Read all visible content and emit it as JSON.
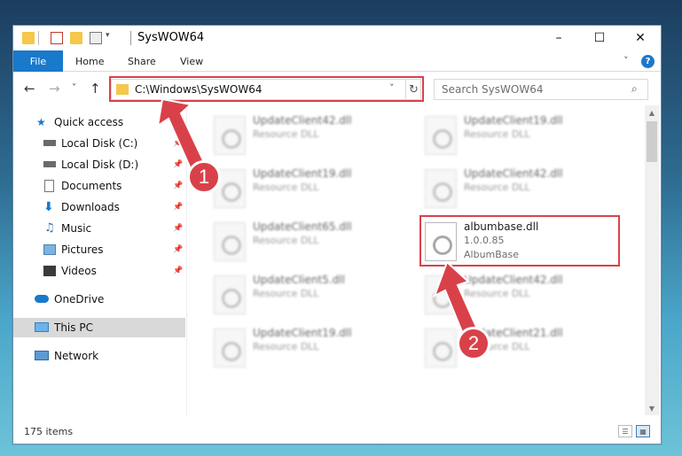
{
  "window": {
    "title": "SysWOW64",
    "controls": {
      "minimize": "–",
      "maximize": "☐",
      "close": "✕"
    }
  },
  "ribbon": {
    "tabs": [
      "File",
      "Home",
      "Share",
      "View"
    ],
    "collapse_glyph": "˅",
    "help_glyph": "?"
  },
  "nav": {
    "back": "←",
    "forward": "→",
    "recent": "˅",
    "up": "↑",
    "address": "C:\\Windows\\SysWOW64",
    "address_dropdown": "˅",
    "refresh": "↻",
    "search_placeholder": "Search SysWOW64",
    "search_glyph": "⌕"
  },
  "sidebar": {
    "items": [
      {
        "label": "Quick access",
        "icon": "star-icon",
        "pinned": false
      },
      {
        "label": "Local Disk (C:)",
        "icon": "drive-icon",
        "pinned": true
      },
      {
        "label": "Local Disk (D:)",
        "icon": "drive-icon",
        "pinned": true
      },
      {
        "label": "Documents",
        "icon": "document-icon",
        "pinned": true
      },
      {
        "label": "Downloads",
        "icon": "download-icon",
        "pinned": true
      },
      {
        "label": "Music",
        "icon": "music-icon",
        "pinned": true
      },
      {
        "label": "Pictures",
        "icon": "pictures-icon",
        "pinned": true
      },
      {
        "label": "Videos",
        "icon": "video-icon",
        "pinned": true
      },
      {
        "label": "OneDrive",
        "icon": "cloud-icon",
        "pinned": false
      },
      {
        "label": "This PC",
        "icon": "computer-icon",
        "pinned": false,
        "selected": true
      },
      {
        "label": "Network",
        "icon": "network-icon",
        "pinned": false
      }
    ]
  },
  "files": {
    "left_column": [
      {
        "name": "UpdateClient42.dll",
        "type": "Resource DLL"
      },
      {
        "name": "UpdateClient19.dll",
        "type": "Resource DLL"
      },
      {
        "name": "UpdateClient65.dll",
        "type": "Resource DLL"
      },
      {
        "name": "UpdateClient5.dll",
        "type": "Resource DLL"
      },
      {
        "name": "UpdateClient19.dll",
        "type": "Resource DLL"
      }
    ],
    "right_column": [
      {
        "name": "UpdateClient19.dll",
        "type": "Resource DLL"
      },
      {
        "name": "UpdateClient42.dll",
        "type": "Resource DLL"
      },
      {
        "name": "albumbase.dll",
        "version": "1.0.0.85",
        "description": "AlbumBase",
        "highlighted": true
      },
      {
        "name": "UpdateClient42.dll",
        "type": "Resource DLL"
      },
      {
        "name": "UpdateClient21.dll",
        "type": "Resource DLL"
      }
    ]
  },
  "status": {
    "item_count": "175 items"
  },
  "annotations": {
    "step1": "1",
    "step2": "2",
    "color": "#d9414a"
  }
}
